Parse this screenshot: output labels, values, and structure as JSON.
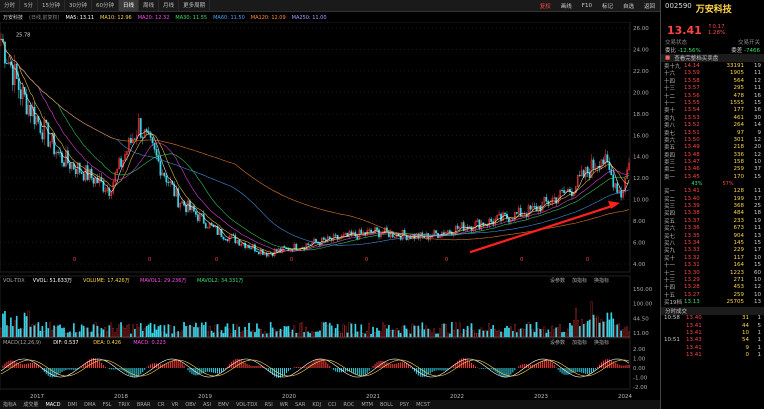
{
  "timeframes": [
    "分时",
    "5分",
    "15分钟",
    "30分钟",
    "60分钟",
    "日线",
    "周线",
    "月线",
    "更多周期"
  ],
  "active_timeframe": 5,
  "toolbar_right": [
    "复权",
    "画线",
    "F10",
    "标记",
    "自选",
    "返回"
  ],
  "ma_legend": [
    {
      "label": "万安科技",
      "color": "#dddddd"
    },
    {
      "label": "(日线,前复权)",
      "color": "#888888"
    },
    {
      "label": "MA5: 13.11",
      "color": "#ffffff"
    },
    {
      "label": "MA10: 12.96",
      "color": "#ffd54a"
    },
    {
      "label": "MA20: 12.32",
      "color": "#ff4df0"
    },
    {
      "label": "MA30: 11.55",
      "color": "#3ae06a"
    },
    {
      "label": "MA60: 11.50",
      "color": "#4da6ff"
    },
    {
      "label": "MA120: 12.09",
      "color": "#ff8c2e"
    },
    {
      "label": "MA250: 11.00",
      "color": "#a0a0ff"
    }
  ],
  "price_axis": [
    "26.00",
    "24.00",
    "22.00",
    "20.00",
    "18.00",
    "16.00",
    "14.00",
    "12.00",
    "10.00",
    "8.00",
    "6.00",
    "4.00"
  ],
  "high_label": "25.78",
  "vol_legend": [
    {
      "label": "VOL-TDX",
      "color": "#aaaaaa"
    },
    {
      "label": "VVOL: 51.633万",
      "color": "#ffffff"
    },
    {
      "label": "VOLUME: 17.426万",
      "color": "#ffd54a"
    },
    {
      "label": "MAVOL1: 29.236万",
      "color": "#ff4df0"
    },
    {
      "label": "MAVOL2: 34.331万",
      "color": "#3ae06a"
    }
  ],
  "vol_axis": [
    "150.00",
    "100.00",
    "44.50",
    "11.00"
  ],
  "macd_legend": [
    {
      "label": "MACD(12,26,9)",
      "color": "#aaaaaa"
    },
    {
      "label": "DIF: 0.537",
      "color": "#ffffff"
    },
    {
      "label": "DEA: 0.426",
      "color": "#ffd54a"
    },
    {
      "label": "MACD: 0.223",
      "color": "#ff4df0"
    }
  ],
  "macd_axis": [
    "2.00",
    "1.00",
    "0.00",
    "-1.00",
    "-2.00"
  ],
  "sub_buttons": [
    "设参数",
    "加指标",
    "换指标"
  ],
  "years": [
    "2017",
    "2018",
    "2019",
    "2020",
    "2021",
    "2022",
    "2023",
    "2024"
  ],
  "bottom_tabs": [
    "指标A",
    "成交量",
    "MACD",
    "DMI",
    "DMA",
    "FSL",
    "TRIX",
    "BRAR",
    "CR",
    "VR",
    "OBV",
    "ASI",
    "EMV",
    "VOL-TDX",
    "RSI",
    "WR",
    "SAR",
    "KDJ",
    "CCI",
    "ROC",
    "MTM",
    "BOLL",
    "PSY",
    "MCST"
  ],
  "panel": {
    "code": "002590",
    "name": "万安科技",
    "price": "13.41",
    "change": "0.17",
    "change_pct": "1.28%",
    "row1": {
      "left": "委比",
      "left_val": "-12.56%",
      "right": "委差",
      "right_val": "-7466"
    },
    "row2": {
      "left": "交易状态",
      "right": "交易开关"
    },
    "notice": "查看完整档买卖盘",
    "sell": [
      {
        "l": "卖十九",
        "p": "14.14",
        "v": "33191",
        "c": "19"
      },
      {
        "l": "十六",
        "p": "13.59",
        "v": "1905",
        "c": "11"
      },
      {
        "l": "十四",
        "p": "13.58",
        "v": "564",
        "c": "12"
      },
      {
        "l": "十三",
        "p": "13.57",
        "v": "295",
        "c": "11"
      },
      {
        "l": "十二",
        "p": "13.56",
        "v": "478",
        "c": "16"
      },
      {
        "l": "十一",
        "p": "13.55",
        "v": "1555",
        "c": "15"
      },
      {
        "l": "卖十",
        "p": "13.54",
        "v": "177",
        "c": "16"
      },
      {
        "l": "卖九",
        "p": "13.53",
        "v": "461",
        "c": "30"
      },
      {
        "l": "卖八",
        "p": "13.52",
        "v": "264",
        "c": "14"
      },
      {
        "l": "卖七",
        "p": "13.51",
        "v": "97",
        "c": "9"
      },
      {
        "l": "卖六",
        "p": "13.50",
        "v": "301",
        "c": "12"
      },
      {
        "l": "卖五",
        "p": "13.49",
        "v": "218",
        "c": "20"
      },
      {
        "l": "卖四",
        "p": "13.48",
        "v": "336",
        "c": "12"
      },
      {
        "l": "卖三",
        "p": "13.47",
        "v": "158",
        "c": "10"
      },
      {
        "l": "卖二",
        "p": "13.46",
        "v": "259",
        "c": "37"
      },
      {
        "l": "卖一",
        "p": "13.45",
        "v": "170",
        "c": "15"
      }
    ],
    "mid_left": "43%",
    "mid_right": "57%",
    "buy": [
      {
        "l": "买一",
        "p": "13.41",
        "v": "128",
        "c": "11"
      },
      {
        "l": "买二",
        "p": "13.40",
        "v": "199",
        "c": "17"
      },
      {
        "l": "买三",
        "p": "13.39",
        "v": "368",
        "c": "25"
      },
      {
        "l": "买四",
        "p": "13.38",
        "v": "484",
        "c": "18"
      },
      {
        "l": "买五",
        "p": "13.37",
        "v": "233",
        "c": "19"
      },
      {
        "l": "买六",
        "p": "13.36",
        "v": "673",
        "c": "11"
      },
      {
        "l": "买七",
        "p": "13.35",
        "v": "904",
        "c": "13"
      },
      {
        "l": "买八",
        "p": "13.34",
        "v": "145",
        "c": "15"
      },
      {
        "l": "买九",
        "p": "13.33",
        "v": "229",
        "c": "17"
      },
      {
        "l": "买十",
        "p": "13.32",
        "v": "117",
        "c": "10"
      },
      {
        "l": "十一",
        "p": "13.31",
        "v": "164",
        "c": "15"
      },
      {
        "l": "十二",
        "p": "13.30",
        "v": "1223",
        "c": "60"
      },
      {
        "l": "十三",
        "p": "13.29",
        "v": "271",
        "c": "10"
      },
      {
        "l": "十四",
        "p": "13.28",
        "v": "453",
        "c": "12"
      },
      {
        "l": "十五",
        "p": "13.27",
        "v": "259",
        "c": "10"
      }
    ],
    "buy_total": {
      "l": "买19档",
      "p": "13.13",
      "v": "25705",
      "c": "13"
    },
    "ticks_title": "分时成交",
    "ticks": [
      {
        "t": "10:58",
        "p": "13.40",
        "v": "31",
        "c": "1"
      },
      {
        "t": "",
        "p": "13.41",
        "v": "44",
        "c": "5"
      },
      {
        "t": "",
        "p": "13.41",
        "v": "10",
        "c": "1"
      },
      {
        "t": "10:51",
        "p": "13.43",
        "v": "54",
        "c": "1"
      },
      {
        "t": "",
        "p": "13.41",
        "v": "9",
        "c": "1"
      },
      {
        "t": "",
        "p": "13.41",
        "v": "0",
        "c": "1"
      }
    ]
  }
}
